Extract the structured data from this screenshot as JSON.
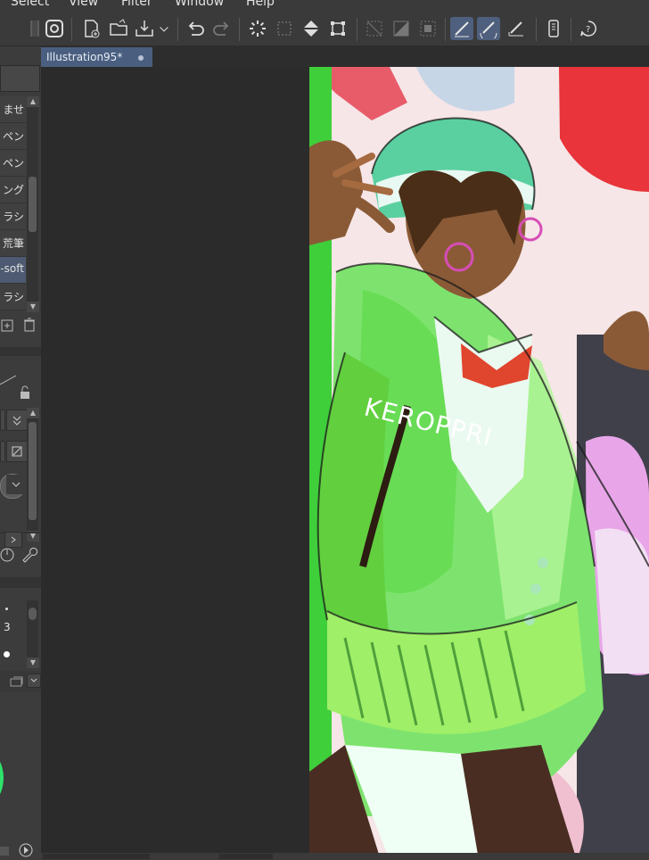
{
  "menu": {
    "items": [
      "Select",
      "View",
      "Filter",
      "Window",
      "Help"
    ]
  },
  "tab": {
    "title": "Illustration95*"
  },
  "brush_list": {
    "items": [
      "ませ",
      "ペン",
      "ペン",
      "ング",
      "ラシ",
      "荒筆",
      "-soft",
      "ラシ"
    ],
    "selected_index": 6
  },
  "tool_property": {
    "size_value": "3"
  },
  "artwork": {
    "watermark": "KEROPPRI"
  },
  "colors": {
    "accent": "#4f5f7e",
    "tab_active": "#4a5f80",
    "panel_bg": "#3c3c3c",
    "canvas_bg": "#2b2b2b",
    "color_wheel_green": "#2ee36b"
  }
}
